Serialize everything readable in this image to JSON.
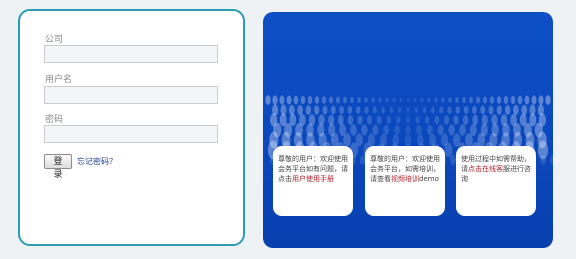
{
  "login": {
    "company_label": "公司",
    "username_label": "用户名",
    "password_label": "密码",
    "login_button": "登录",
    "forgot_link": "忘记密码？"
  },
  "cards": [
    {
      "text_before": "尊敬的用户：欢迎使用会务平台如有问题，请点击",
      "highlight": "用户使用手册",
      "text_after": ""
    },
    {
      "text_before": "尊敬的用户：欢迎使用会务平台，如需培训，请查看",
      "highlight": "视频培训",
      "text_after": "demo"
    },
    {
      "text_before": "使用过程中如需帮助，请",
      "highlight": "点击在线客",
      "text_after": "服进行咨询"
    }
  ],
  "colors": {
    "login_border": "#2a9cb6",
    "panel_blue": "#0a47bd",
    "link_blue": "#1d3f9c",
    "highlight_red": "#b2222b"
  }
}
